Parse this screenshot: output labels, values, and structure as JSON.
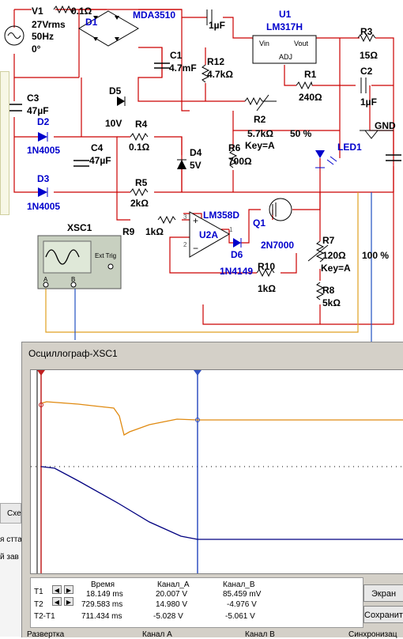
{
  "circuit": {
    "v1": {
      "name": "V1",
      "voltage": "27Vrms",
      "freq": "50Hz",
      "phase": "0°"
    },
    "fuse_value": "0.1Ω",
    "d1": {
      "name": "D1",
      "part": "MDA3510"
    },
    "c_top": {
      "value": "1µF"
    },
    "u1": {
      "name": "U1",
      "part": "LM317H",
      "vin": "Vin",
      "vout": "Vout",
      "adj": "ADJ"
    },
    "r3": {
      "name": "R3",
      "value": "15Ω"
    },
    "c1": {
      "name": "C1",
      "value": "4.7mF"
    },
    "r12": {
      "name": "R12",
      "value": "4.7kΩ"
    },
    "r1": {
      "name": "R1",
      "value": "240Ω"
    },
    "c2": {
      "name": "C2",
      "value": "1µF"
    },
    "c3": {
      "name": "C3",
      "value": "47µF"
    },
    "d5": {
      "name": "D5",
      "value": "10V"
    },
    "r2": {
      "name": "R2",
      "value": "5.7kΩ",
      "key": "Key=A",
      "percent": "50 %"
    },
    "gnd": "GND",
    "d2": {
      "name": "D2",
      "part": "1N4005"
    },
    "r4": {
      "name": "R4",
      "value": "0.1Ω"
    },
    "led1": "LED1",
    "c4": {
      "name": "C4",
      "value": "47µF"
    },
    "d4": {
      "name": "D4",
      "value": "5V"
    },
    "r6": {
      "name": "R6",
      "value": "700Ω"
    },
    "d3": {
      "name": "D3",
      "part": "1N4005"
    },
    "r5": {
      "name": "R5",
      "value": "2kΩ"
    },
    "u2": {
      "name": "U2A",
      "part": "LM358D",
      "pin3": "3",
      "pin2": "2",
      "pin1": "1"
    },
    "q1": {
      "name": "Q1",
      "part": "2N7000"
    },
    "r9": {
      "name": "R9",
      "value": "1kΩ"
    },
    "xsc1": {
      "name": "XSC1",
      "ext_trig": "Ext Trig",
      "a": "A",
      "b": "B"
    },
    "d6": {
      "name": "D6",
      "part": "1N4149"
    },
    "r7": {
      "name": "R7",
      "value": "120Ω",
      "key": "Key=A",
      "percent": "100 %"
    },
    "r10": {
      "name": "R10",
      "value": "1kΩ"
    },
    "r8": {
      "name": "R8",
      "value": "5kΩ"
    }
  },
  "background_app": {
    "tab_label": "Схе",
    "text_fragments": [
      "я стта",
      "й зав"
    ]
  },
  "oscilloscope": {
    "title": "Осциллограф-XSC1",
    "colors": {
      "channel_a": "#e08a10",
      "channel_b": "#000080",
      "cursor": "#3050c0"
    },
    "readout": {
      "headers": [
        "Время",
        "Канал_A",
        "Канал_B"
      ],
      "rows": [
        {
          "label": "T1",
          "time": "18.149 ms",
          "a": "20.007 V",
          "b": "85.459 mV"
        },
        {
          "label": "T2",
          "time": "729.583 ms",
          "a": "14.980 V",
          "b": "-4.976 V"
        },
        {
          "label": "T2-T1",
          "time": "711.434 ms",
          "a": "-5.028 V",
          "b": "-5.061 V"
        }
      ]
    },
    "buttons": {
      "screen": "Экран",
      "save": "Сохранит"
    },
    "bottom_tabs": [
      "Развертка",
      "Канал A",
      "Канал B",
      "Синхронизац"
    ]
  }
}
